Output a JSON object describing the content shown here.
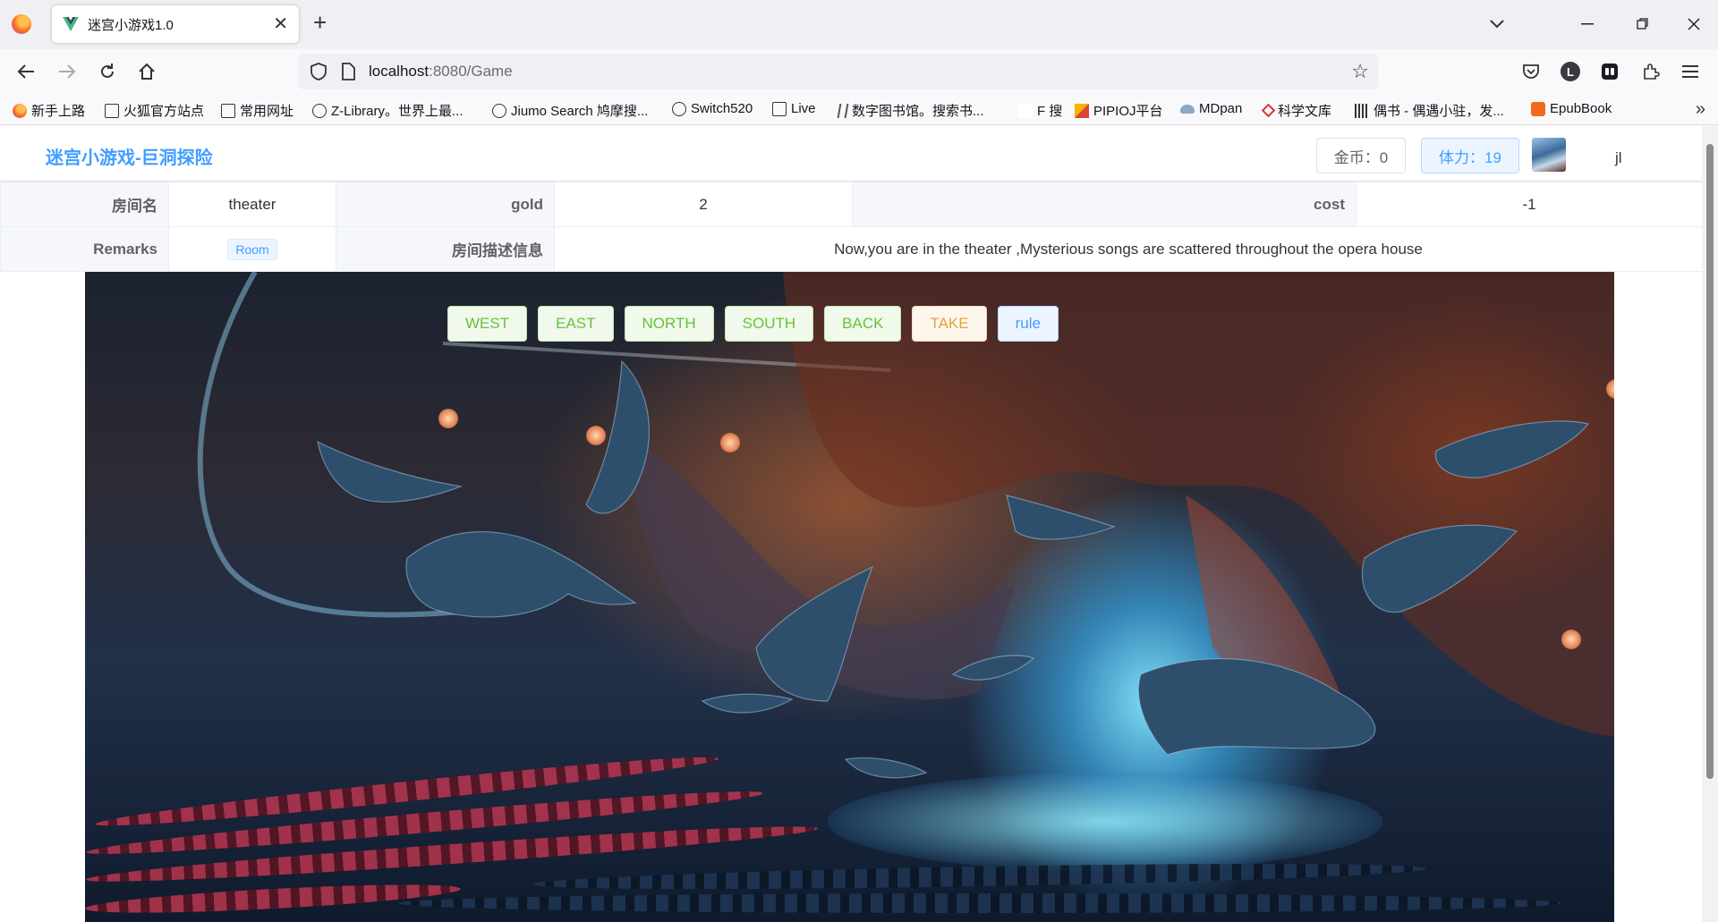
{
  "browser": {
    "tab_title": "迷宫小游戏1.0",
    "tab_close": "✕",
    "new_tab": "+",
    "url_host": "localhost",
    "url_rest": ":8080/Game",
    "bookmarks": [
      {
        "label": "新手上路",
        "icon": "firefox-icon"
      },
      {
        "label": "火狐官方站点",
        "icon": "folder-icon"
      },
      {
        "label": "常用网址",
        "icon": "folder-icon"
      },
      {
        "label": "Z-Library。世界上最...",
        "icon": "globe-icon"
      },
      {
        "label": "Jiumo Search 鸠摩搜...",
        "icon": "globe-icon"
      },
      {
        "label": "Switch520",
        "icon": "globe-icon"
      },
      {
        "label": "Live",
        "icon": "play-box-icon"
      },
      {
        "label": "数字图书馆。搜索书...",
        "icon": "y-logo-icon"
      },
      {
        "label": "F 搜",
        "icon": "f-logo-icon"
      },
      {
        "label": "PIPIOJ平台",
        "icon": "colorful-square-icon"
      },
      {
        "label": "MDpan",
        "icon": "cloud-icon"
      },
      {
        "label": "科学文库",
        "icon": "diamond-icon"
      },
      {
        "label": "偶书 - 偶遇小驻，发...",
        "icon": "barcode-icon"
      },
      {
        "label": "EpubBook",
        "icon": "orange-b-icon"
      }
    ]
  },
  "header": {
    "site_title": "迷宫小游戏-巨洞探险",
    "gold_label": "金币：0",
    "stamina_label": "体力：19",
    "username": "jl"
  },
  "room_info": {
    "name_label": "房间名",
    "name_value": "theater",
    "gold_label": "gold",
    "gold_value": "2",
    "cost_label": "cost",
    "cost_value": "-1",
    "remarks_label": "Remarks",
    "remarks_tag": "Room",
    "desc_label": "房间描述信息",
    "desc_value": "Now,you are in the theater ,Mysterious songs are scattered throughout the opera house"
  },
  "game_buttons": [
    {
      "label": "WEST",
      "style": "green"
    },
    {
      "label": "EAST",
      "style": "green"
    },
    {
      "label": "NORTH",
      "style": "green"
    },
    {
      "label": "SOUTH",
      "style": "green"
    },
    {
      "label": "BACK",
      "style": "green"
    },
    {
      "label": "TAKE",
      "style": "orange"
    },
    {
      "label": "rule",
      "style": "blue"
    }
  ],
  "colors": {
    "primary": "#409eff",
    "success": "#67c23a",
    "warning": "#e6a23c"
  }
}
